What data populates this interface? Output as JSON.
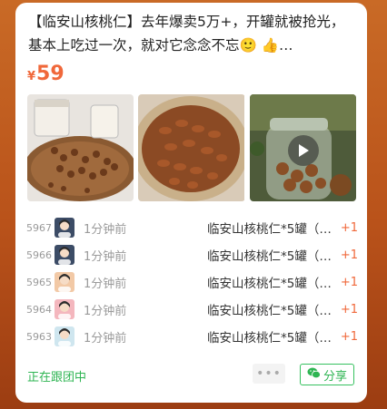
{
  "product": {
    "title": "【临安山核桃仁】去年爆卖5万+，开罐就被抢光，基本上吃过一次，就对它念念不忘🙂 👍…",
    "currency": "¥",
    "price": "59"
  },
  "photos": [
    {
      "name": "photo-jar-walnuts"
    },
    {
      "name": "photo-walnuts-basket"
    },
    {
      "name": "photo-glass-jar-video",
      "video": true
    }
  ],
  "orders": [
    {
      "no": "5967",
      "time": "1分钟前",
      "item": "临安山核桃仁*5罐（…",
      "qty": "+1",
      "avatar": "dark"
    },
    {
      "no": "5966",
      "time": "1分钟前",
      "item": "临安山核桃仁*5罐（…",
      "qty": "+1",
      "avatar": "dark"
    },
    {
      "no": "5965",
      "time": "1分钟前",
      "item": "临安山核桃仁*5罐（…",
      "qty": "+1",
      "avatar": "peach"
    },
    {
      "no": "5964",
      "time": "1分钟前",
      "item": "临安山核桃仁*5罐（…",
      "qty": "+1",
      "avatar": "pink"
    },
    {
      "no": "5963",
      "time": "1分钟前",
      "item": "临安山核桃仁*5罐（…",
      "qty": "+1",
      "avatar": "light"
    }
  ],
  "footer": {
    "status": "正在跟团中",
    "more_label": "•••",
    "share_label": "分享"
  },
  "colors": {
    "price": "#f0683a",
    "accent_green": "#2fb553"
  },
  "icons": {
    "play": "play-icon",
    "wechat": "wechat-icon"
  }
}
